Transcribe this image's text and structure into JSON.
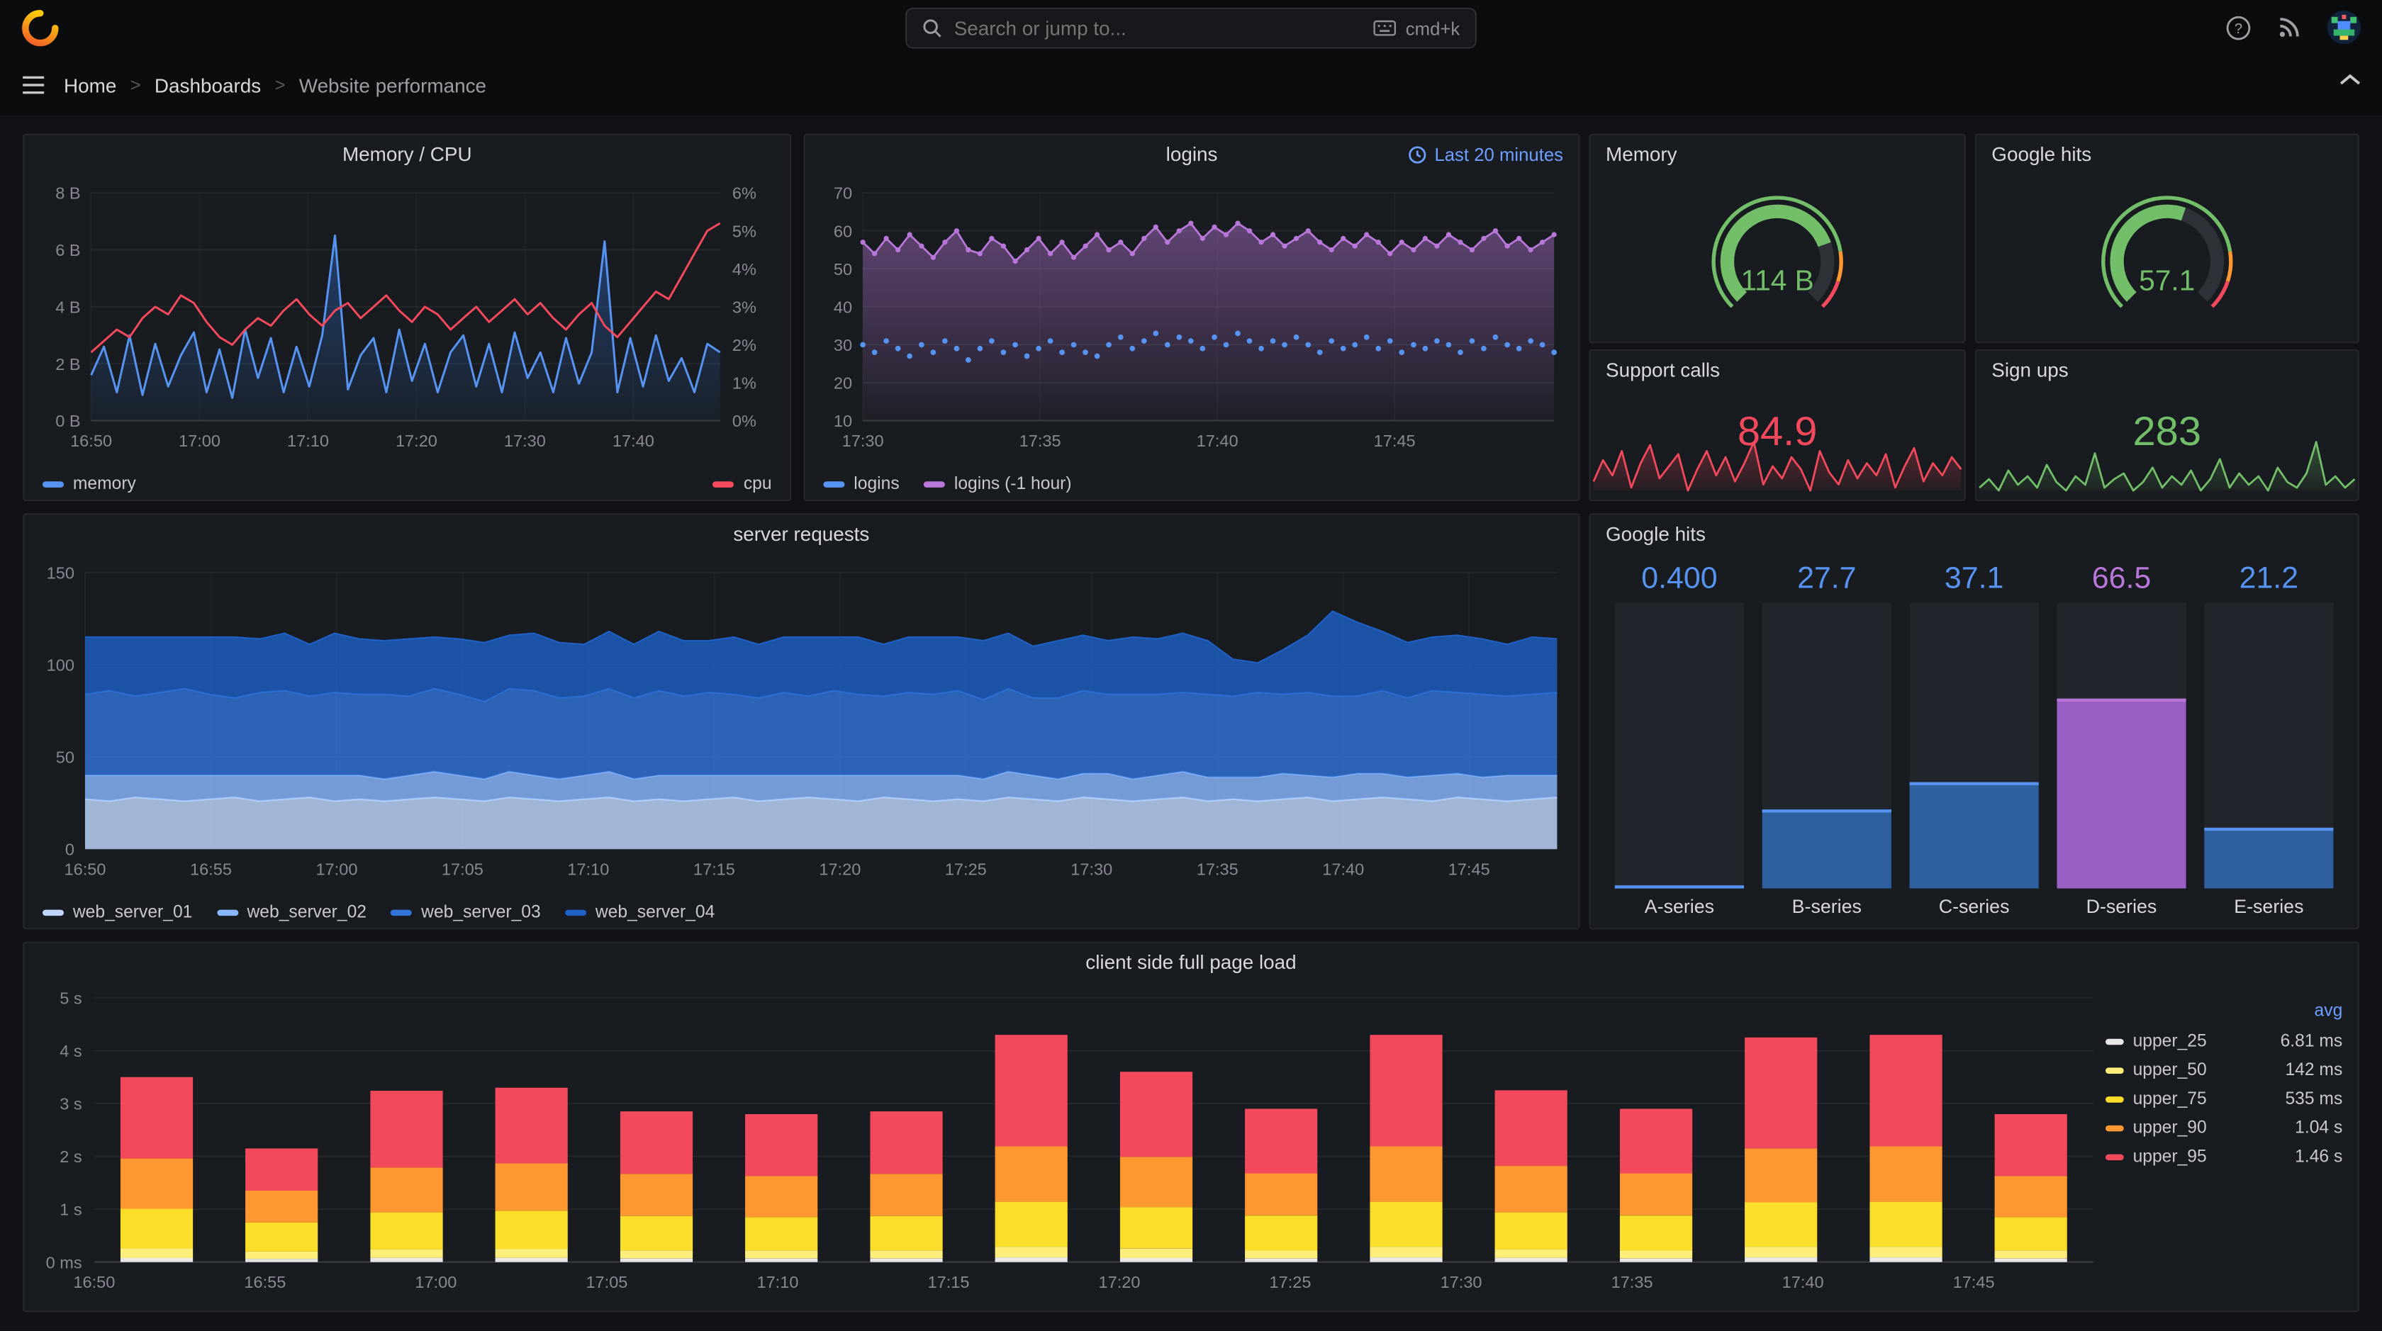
{
  "topbar": {
    "search_placeholder": "Search or jump to...",
    "shortcut_label": "cmd+k"
  },
  "breadcrumb": {
    "home": "Home",
    "dashboards": "Dashboards",
    "current": "Website performance"
  },
  "panels": {
    "memory_cpu": {
      "title": "Memory / CPU",
      "y_left_ticks": [
        "0 B",
        "2 B",
        "4 B",
        "6 B",
        "8 B"
      ],
      "y_right_ticks": [
        "0%",
        "1%",
        "2%",
        "3%",
        "4%",
        "5%",
        "6%"
      ],
      "x_ticks": [
        "16:50",
        "17:00",
        "17:10",
        "17:20",
        "17:30",
        "17:40"
      ],
      "legend": [
        {
          "label": "memory",
          "color": "#5794f2"
        },
        {
          "label": "cpu",
          "color": "#f2495c"
        }
      ],
      "chart": {
        "memory": [
          1.6,
          2.6,
          1.0,
          3.0,
          0.9,
          2.7,
          1.2,
          2.3,
          3.1,
          1.0,
          2.5,
          0.8,
          3.2,
          1.5,
          2.9,
          1.0,
          2.6,
          1.2,
          3.0,
          6.5,
          1.1,
          2.3,
          2.9,
          1.0,
          3.2,
          1.4,
          2.7,
          1.0,
          2.4,
          3.0,
          1.2,
          2.7,
          1.0,
          3.1,
          1.5,
          2.4,
          1.0,
          2.9,
          1.3,
          2.4,
          6.3,
          1.0,
          2.9,
          1.2,
          3.0,
          1.4,
          2.2,
          1.0,
          2.7,
          2.4
        ],
        "cpu": [
          1.8,
          2.1,
          2.4,
          2.2,
          2.7,
          3.0,
          2.8,
          3.3,
          3.1,
          2.6,
          2.2,
          2.0,
          2.4,
          2.7,
          2.5,
          2.9,
          3.2,
          2.8,
          2.5,
          2.9,
          3.1,
          2.7,
          3.0,
          3.3,
          2.9,
          2.6,
          3.0,
          2.8,
          2.4,
          2.7,
          3.0,
          2.6,
          2.9,
          3.2,
          2.8,
          3.1,
          2.7,
          2.4,
          2.8,
          3.1,
          2.5,
          2.2,
          2.6,
          3.0,
          3.4,
          3.2,
          3.8,
          4.4,
          5.0,
          5.2
        ],
        "memory_range": [
          0,
          8
        ],
        "cpu_range": [
          0,
          6
        ]
      }
    },
    "logins": {
      "title": "logins",
      "time_range_label": "Last 20 minutes",
      "y_ticks": [
        "10",
        "20",
        "30",
        "40",
        "50",
        "60",
        "70"
      ],
      "x_ticks": [
        "17:30",
        "17:35",
        "17:40",
        "17:45"
      ],
      "legend": [
        {
          "label": "logins",
          "color": "#5794f2"
        },
        {
          "label": "logins (-1 hour)",
          "color": "#b877d9"
        }
      ],
      "chart": {
        "logins": [
          30,
          28,
          31,
          29,
          27,
          30,
          28,
          31,
          29,
          26,
          29,
          31,
          28,
          30,
          27,
          29,
          31,
          28,
          30,
          28,
          27,
          30,
          32,
          29,
          31,
          33,
          30,
          32,
          31,
          29,
          32,
          30,
          33,
          31,
          29,
          31,
          30,
          32,
          30,
          28,
          31,
          29,
          30,
          32,
          29,
          31,
          28,
          30,
          29,
          31,
          30,
          28,
          31,
          29,
          32,
          30,
          29,
          31,
          30,
          28
        ],
        "logins_prev": [
          57,
          54,
          58,
          55,
          59,
          56,
          53,
          57,
          60,
          55,
          54,
          58,
          56,
          52,
          55,
          58,
          54,
          57,
          53,
          56,
          59,
          55,
          57,
          54,
          58,
          61,
          57,
          60,
          62,
          58,
          61,
          59,
          62,
          60,
          57,
          59,
          56,
          58,
          60,
          57,
          55,
          58,
          56,
          59,
          57,
          54,
          57,
          55,
          58,
          56,
          59,
          57,
          55,
          58,
          60,
          56,
          58,
          55,
          57,
          59
        ],
        "y_range": [
          10,
          70
        ]
      }
    },
    "memory_gauge": {
      "title": "Memory",
      "value": "114 B",
      "percent": 0.76,
      "color": "#73bf69"
    },
    "google_hits_gauge": {
      "title": "Google hits",
      "value": "57.1",
      "percent": 0.571,
      "color": "#73bf69"
    },
    "support_calls": {
      "title": "Support calls",
      "value": "84.9",
      "color": "#f2495c",
      "spark": [
        78,
        85,
        80,
        88,
        76,
        84,
        90,
        79,
        83,
        87,
        75,
        82,
        88,
        80,
        86,
        78,
        84,
        91,
        77,
        83,
        79,
        86,
        82,
        75,
        88,
        81,
        77,
        85,
        79,
        84,
        80,
        87,
        76,
        83,
        89,
        78,
        84,
        80,
        86,
        82
      ]
    },
    "sign_ups": {
      "title": "Sign ups",
      "value": "283",
      "color": "#73bf69",
      "spark": [
        12,
        15,
        11,
        18,
        13,
        16,
        12,
        20,
        14,
        11,
        16,
        13,
        24,
        12,
        15,
        17,
        11,
        14,
        19,
        12,
        16,
        13,
        18,
        11,
        15,
        22,
        12,
        17,
        13,
        16,
        11,
        19,
        14,
        12,
        17,
        28,
        13,
        16,
        12,
        15
      ]
    },
    "server_requests": {
      "title": "server requests",
      "y_ticks": [
        "0",
        "50",
        "100",
        "150"
      ],
      "x_ticks": [
        "16:50",
        "16:55",
        "17:00",
        "17:05",
        "17:10",
        "17:15",
        "17:20",
        "17:25",
        "17:30",
        "17:35",
        "17:40",
        "17:45"
      ],
      "y_max": 150,
      "series": [
        {
          "name": "web_server_01",
          "color": "#c0d8ff",
          "values": [
            27,
            26,
            28,
            27,
            26,
            27,
            28,
            26,
            27,
            28,
            26,
            27,
            26,
            27,
            28,
            27,
            26,
            28,
            27,
            26,
            27,
            28,
            26,
            27,
            26,
            27,
            28,
            26,
            27,
            28,
            27,
            26,
            28,
            27,
            26,
            27,
            26,
            28,
            27,
            26,
            28,
            27,
            26,
            27,
            28,
            26,
            27,
            26,
            27,
            28,
            26,
            27,
            28,
            27,
            26,
            28,
            27,
            26,
            27,
            28
          ]
        },
        {
          "name": "web_server_02",
          "color": "#8ab8ff",
          "values": [
            13,
            14,
            12,
            13,
            14,
            13,
            12,
            14,
            13,
            12,
            14,
            13,
            12,
            13,
            14,
            13,
            12,
            14,
            13,
            12,
            13,
            14,
            12,
            13,
            14,
            13,
            12,
            14,
            13,
            12,
            13,
            14,
            12,
            13,
            14,
            13,
            12,
            14,
            13,
            12,
            13,
            14,
            12,
            13,
            14,
            13,
            12,
            13,
            14,
            12,
            13,
            14,
            13,
            12,
            14,
            13,
            12,
            14,
            13,
            12
          ]
        },
        {
          "name": "web_server_03",
          "color": "#3274d9",
          "values": [
            44,
            46,
            43,
            45,
            47,
            44,
            42,
            45,
            46,
            43,
            45,
            44,
            46,
            43,
            45,
            44,
            42,
            45,
            46,
            44,
            43,
            45,
            44,
            46,
            43,
            45,
            44,
            42,
            45,
            43,
            46,
            44,
            43,
            45,
            44,
            46,
            43,
            45,
            42,
            44,
            45,
            43,
            46,
            44,
            43,
            45,
            44,
            46,
            43,
            45,
            44,
            42,
            45,
            43,
            46,
            44,
            45,
            43,
            44,
            45
          ]
        },
        {
          "name": "web_server_04",
          "color": "#1f60c4",
          "values": [
            31,
            29,
            32,
            30,
            28,
            31,
            33,
            29,
            31,
            28,
            32,
            30,
            29,
            31,
            28,
            30,
            32,
            29,
            31,
            30,
            28,
            31,
            29,
            32,
            30,
            28,
            31,
            29,
            30,
            32,
            29,
            31,
            28,
            30,
            31,
            29,
            32,
            30,
            28,
            31,
            30,
            29,
            31,
            30,
            32,
            29,
            20,
            16,
            24,
            31,
            46,
            40,
            32,
            30,
            29,
            31,
            30,
            28,
            31,
            29
          ]
        }
      ]
    },
    "google_hits_bars": {
      "title": "Google hits",
      "max": 100,
      "bars": [
        {
          "label": "A-series",
          "value": "0.400",
          "num": 0.4,
          "color": "#5794f2",
          "fill": "#3263a8"
        },
        {
          "label": "B-series",
          "value": "27.7",
          "num": 27.7,
          "color": "#5794f2",
          "fill": "#2e5f9e"
        },
        {
          "label": "C-series",
          "value": "37.1",
          "num": 37.1,
          "color": "#5794f2",
          "fill": "#2e5f9e"
        },
        {
          "label": "D-series",
          "value": "66.5",
          "num": 66.5,
          "color": "#b877d9",
          "fill": "#9a5fc4"
        },
        {
          "label": "E-series",
          "value": "21.2",
          "num": 21.2,
          "color": "#5794f2",
          "fill": "#2e5f9e"
        }
      ]
    },
    "client_load": {
      "title": "client side full page load",
      "y_ticks": [
        "0 ms",
        "1 s",
        "2 s",
        "3 s",
        "4 s",
        "5 s"
      ],
      "x_ticks": [
        "16:50",
        "16:55",
        "17:00",
        "17:05",
        "17:10",
        "17:15",
        "17:20",
        "17:25",
        "17:30",
        "17:35",
        "17:40",
        "17:45"
      ],
      "legend_header": "avg",
      "legend": [
        {
          "label": "upper_25",
          "value": "6.81 ms",
          "color": "#e8e8e8"
        },
        {
          "label": "upper_50",
          "value": "142 ms",
          "color": "#ffee7a"
        },
        {
          "label": "upper_75",
          "value": "535 ms",
          "color": "#fade2a"
        },
        {
          "label": "upper_90",
          "value": "1.04 s",
          "color": "#ff9830"
        },
        {
          "label": "upper_95",
          "value": "1.46 s",
          "color": "#f2495c"
        }
      ],
      "bars": [
        [
          0.08,
          0.18,
          0.75,
          0.95,
          1.54
        ],
        [
          0.06,
          0.14,
          0.55,
          0.6,
          0.8
        ],
        [
          0.08,
          0.16,
          0.7,
          0.85,
          1.45
        ],
        [
          0.08,
          0.17,
          0.72,
          0.9,
          1.43
        ],
        [
          0.07,
          0.15,
          0.65,
          0.8,
          1.18
        ],
        [
          0.07,
          0.15,
          0.63,
          0.78,
          1.17
        ],
        [
          0.07,
          0.15,
          0.65,
          0.8,
          1.18
        ],
        [
          0.09,
          0.2,
          0.85,
          1.05,
          2.11
        ],
        [
          0.08,
          0.18,
          0.78,
          0.95,
          1.61
        ],
        [
          0.07,
          0.15,
          0.66,
          0.8,
          1.22
        ],
        [
          0.09,
          0.2,
          0.85,
          1.05,
          2.11
        ],
        [
          0.08,
          0.16,
          0.7,
          0.88,
          1.43
        ],
        [
          0.07,
          0.15,
          0.66,
          0.8,
          1.22
        ],
        [
          0.09,
          0.2,
          0.84,
          1.02,
          2.1
        ],
        [
          0.09,
          0.2,
          0.85,
          1.05,
          2.11
        ],
        [
          0.07,
          0.15,
          0.63,
          0.78,
          1.17
        ]
      ]
    }
  }
}
